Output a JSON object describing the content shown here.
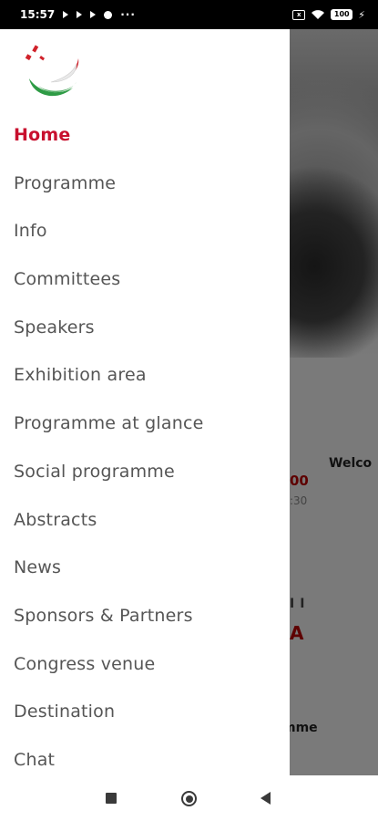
{
  "status_bar": {
    "time": "15:57",
    "more": "···",
    "battery": "100",
    "charging_icon": "⚡",
    "sim_label": "x"
  },
  "background": {
    "welcome_text": "Welco",
    "time_text": "00",
    "time_text_2": ":30",
    "logo_fragment": "A",
    "logo_bars": "II",
    "programme_text": "mme"
  },
  "drawer": {
    "menu": [
      {
        "label": "Home",
        "active": true
      },
      {
        "label": "Programme"
      },
      {
        "label": "Info"
      },
      {
        "label": "Committees"
      },
      {
        "label": "Speakers"
      },
      {
        "label": "Exhibition area"
      },
      {
        "label": "Programme at glance"
      },
      {
        "label": "Social programme"
      },
      {
        "label": "Abstracts"
      },
      {
        "label": "News"
      },
      {
        "label": "Sponsors & Partners"
      },
      {
        "label": "Congress venue"
      },
      {
        "label": "Destination"
      },
      {
        "label": "Chat"
      }
    ]
  },
  "colors": {
    "accent": "#c8102e",
    "menu_text": "#555555",
    "logo_green": "#2e9b45",
    "logo_red": "#d0222b"
  },
  "icons": {
    "nav_recents": "square-icon",
    "nav_home": "home-circle-icon",
    "nav_back": "back-triangle-icon"
  }
}
